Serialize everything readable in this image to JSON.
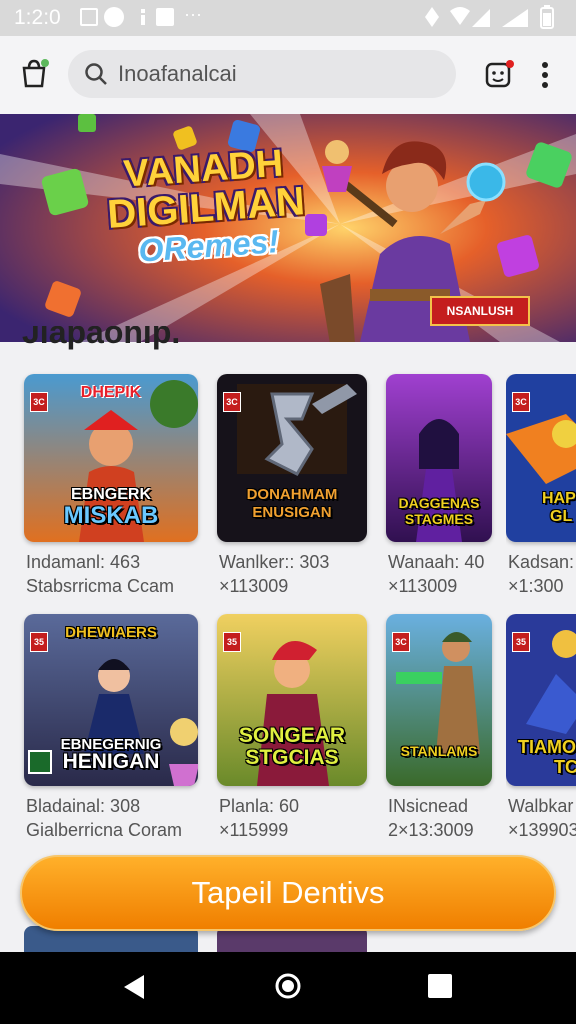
{
  "status_bar": {
    "time": "1:2:0"
  },
  "top_bar": {
    "search_placeholder": "Inoafanalcai"
  },
  "banner": {
    "title_line1": "VANADH",
    "title_line2": "DIGILMAN",
    "title_line3": "ORemes!",
    "badge": "NSANLUSH"
  },
  "section": {
    "heading": "Jiapaonip."
  },
  "games_row1": [
    {
      "tag": "3C",
      "title_top": "DHEPIK",
      "title_line1": "EBNGERK",
      "title_line2": "MISKAB",
      "meta1": "Indamanl: 463",
      "meta2": "Stabsrricma Ccam"
    },
    {
      "tag": "3C",
      "title_top": "",
      "title_line1": "DONAHMAM",
      "title_line2": "ENUSIGAN",
      "meta1": "Wanlker:: 303",
      "meta2": "×113009"
    },
    {
      "tag": "3C",
      "title_top": "",
      "title_line1": "DAGGENAS",
      "title_line2": "STAGMES",
      "meta1": "Wanaah: 40",
      "meta2": "×113009"
    },
    {
      "tag": "3C",
      "title_top": "",
      "title_line1": "HAP",
      "title_line2": "GL",
      "meta1": "Kadsan:",
      "meta2": "×1:300"
    }
  ],
  "games_row2": [
    {
      "tag": "35",
      "title_top": "DHEWIAERS",
      "title_line1": "EBNEGERNIG",
      "title_line2": "HENIGAN",
      "meta1": "Bladainal: 308",
      "meta2": "Gialberricna Coram"
    },
    {
      "tag": "35",
      "title_top": "",
      "title_line1": "SONGEAR",
      "title_line2": "STGCIAS",
      "meta1": "Planla: 60",
      "meta2": "×115999"
    },
    {
      "tag": "3C",
      "title_top": "",
      "title_line1": "STANLAMS",
      "title_line2": "",
      "meta1": "INsicnead",
      "meta2": "2×13:3009"
    },
    {
      "tag": "35",
      "title_top": "",
      "title_line1": "TIAMO",
      "title_line2": "TC",
      "meta1": "Walbkar",
      "meta2": "×139903"
    }
  ],
  "cta": {
    "label": "Tapeil Dentivs"
  },
  "colors": {
    "accent_orange": "#f39200",
    "tag_red": "#c41e1e",
    "status_bar": "#d9d9d9"
  }
}
